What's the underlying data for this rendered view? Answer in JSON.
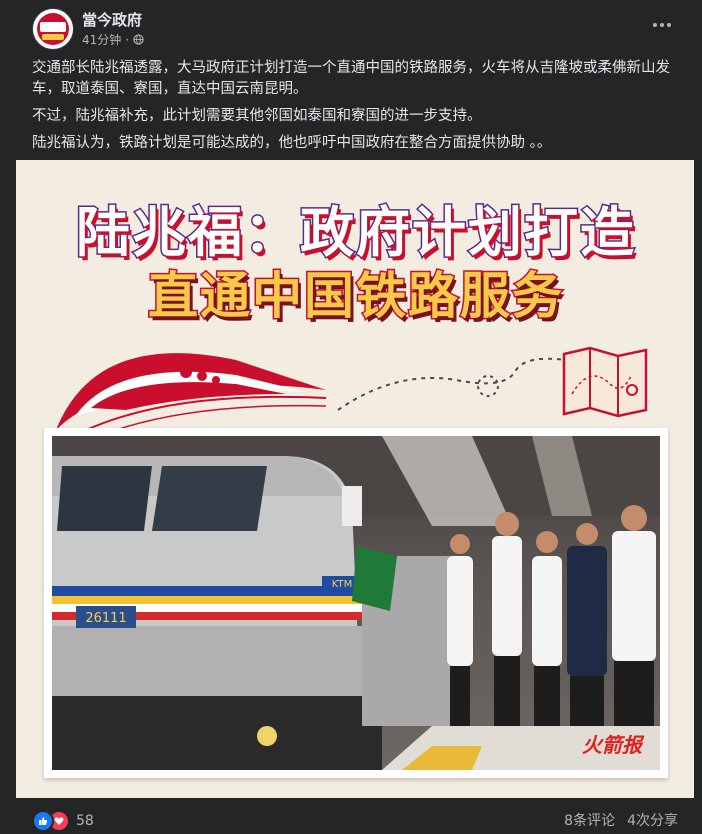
{
  "post": {
    "page_name": "當今政府",
    "time_ago": "41分钟",
    "separator": "·",
    "paragraphs": [
      "交通部长陆兆福透露，大马政府正计划打造一个直通中国的铁路服务，火车将从吉隆坡或柔佛新山发车，取道泰国、寮国，直达中国云南昆明。",
      "不过，陆兆福补充，此计划需要其他邻国如泰国和寮国的进一步支持。",
      "陆兆福认为，铁路计划是可能达成的，他也呼吁中国政府在整合方面提供协助 。。"
    ]
  },
  "image": {
    "headline_line1": "陆兆福：政府计划打造",
    "headline_line2": "直通中国铁路服务",
    "train_number": "26111",
    "train_logo": "KTM",
    "watermark": "火箭报"
  },
  "footer": {
    "reaction_count": "58",
    "comments": "8条评论",
    "shares": "4次分享"
  },
  "colors": {
    "background": "#242526",
    "text": "#e4e6eb",
    "secondary_text": "#b0b3b8",
    "like_blue": "#1877f2",
    "love_red": "#f33e58"
  }
}
